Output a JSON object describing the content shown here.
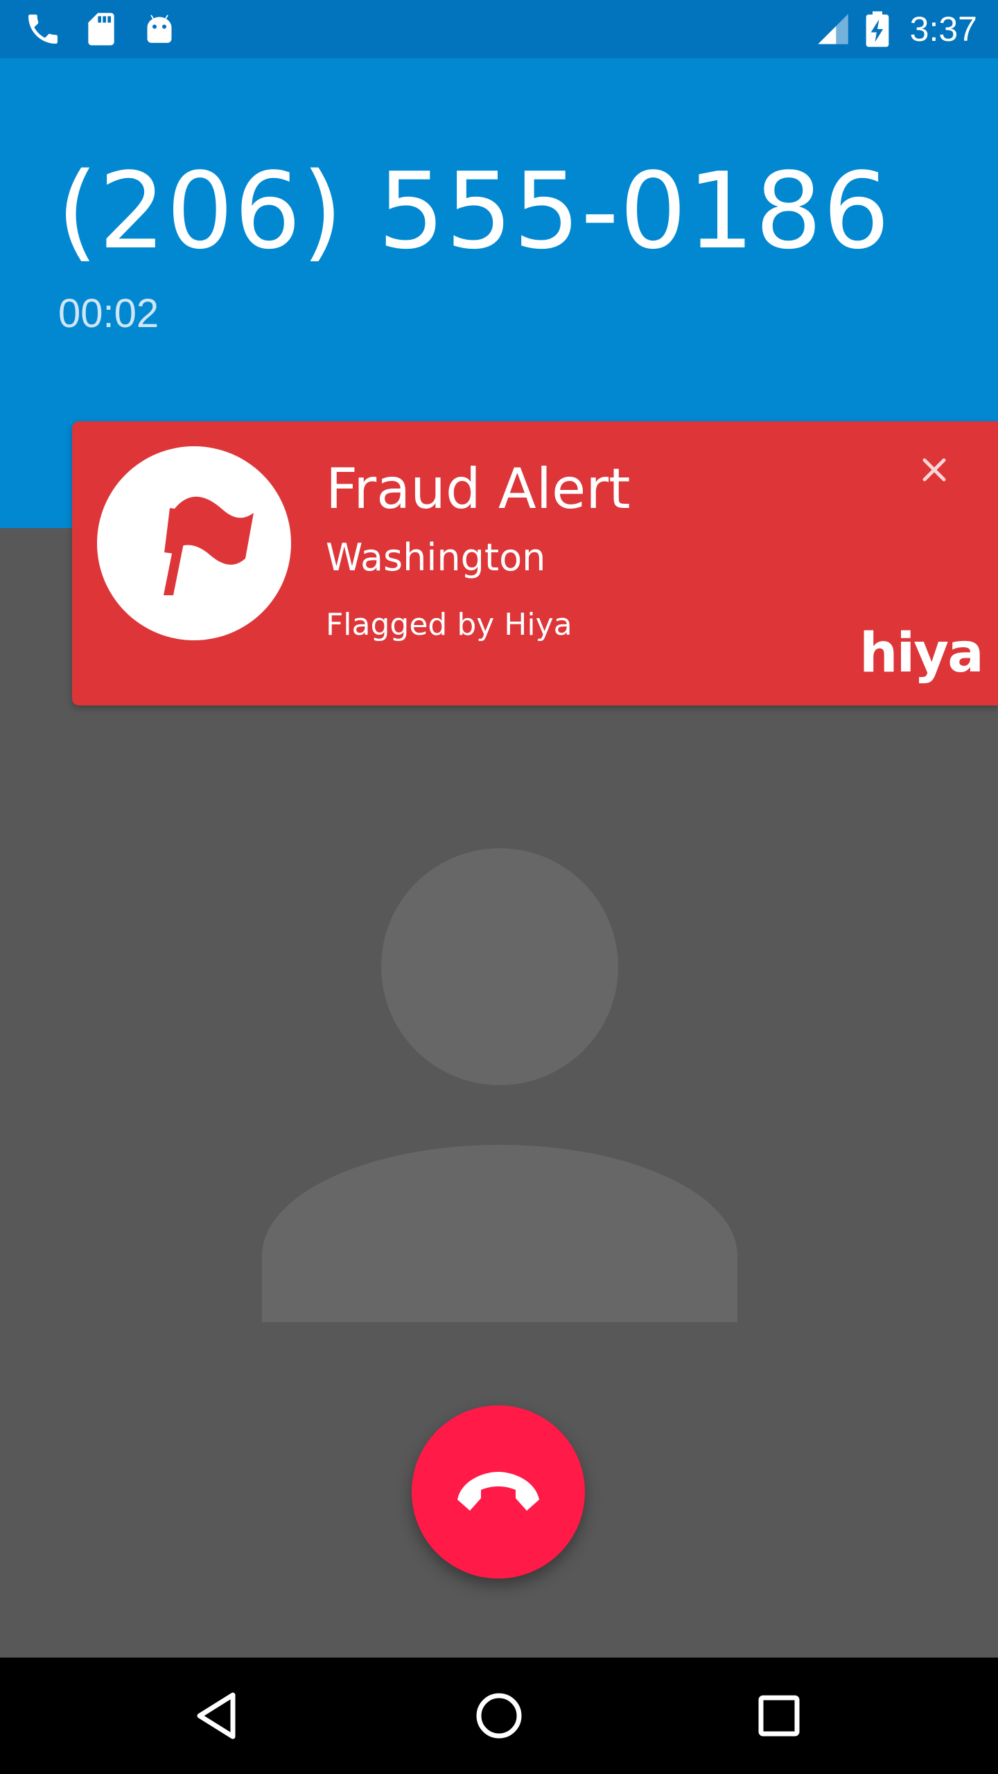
{
  "status_bar": {
    "time": "3:37",
    "left_icons": [
      "phone-icon",
      "sd-card-icon",
      "android-icon"
    ],
    "right_icons": [
      "signal-icon",
      "battery-charging-icon"
    ]
  },
  "call": {
    "phone_number": "(206) 555-0186",
    "elapsed": "00:02"
  },
  "alert": {
    "title": "Fraud Alert",
    "location": "Washington",
    "source": "Flagged by Hiya",
    "brand": "hiya",
    "icon": "flag-icon",
    "color": "#dd3538"
  },
  "avatar": {
    "icon": "default-contact-avatar"
  },
  "end_call": {
    "icon": "hang-up-icon",
    "color": "#ff1a48"
  },
  "nav_bar": {
    "buttons": [
      "back-icon",
      "home-icon",
      "recents-icon"
    ]
  },
  "colors": {
    "status_bar": "#0273bd",
    "header": "#0288d1",
    "background": "#585858"
  }
}
